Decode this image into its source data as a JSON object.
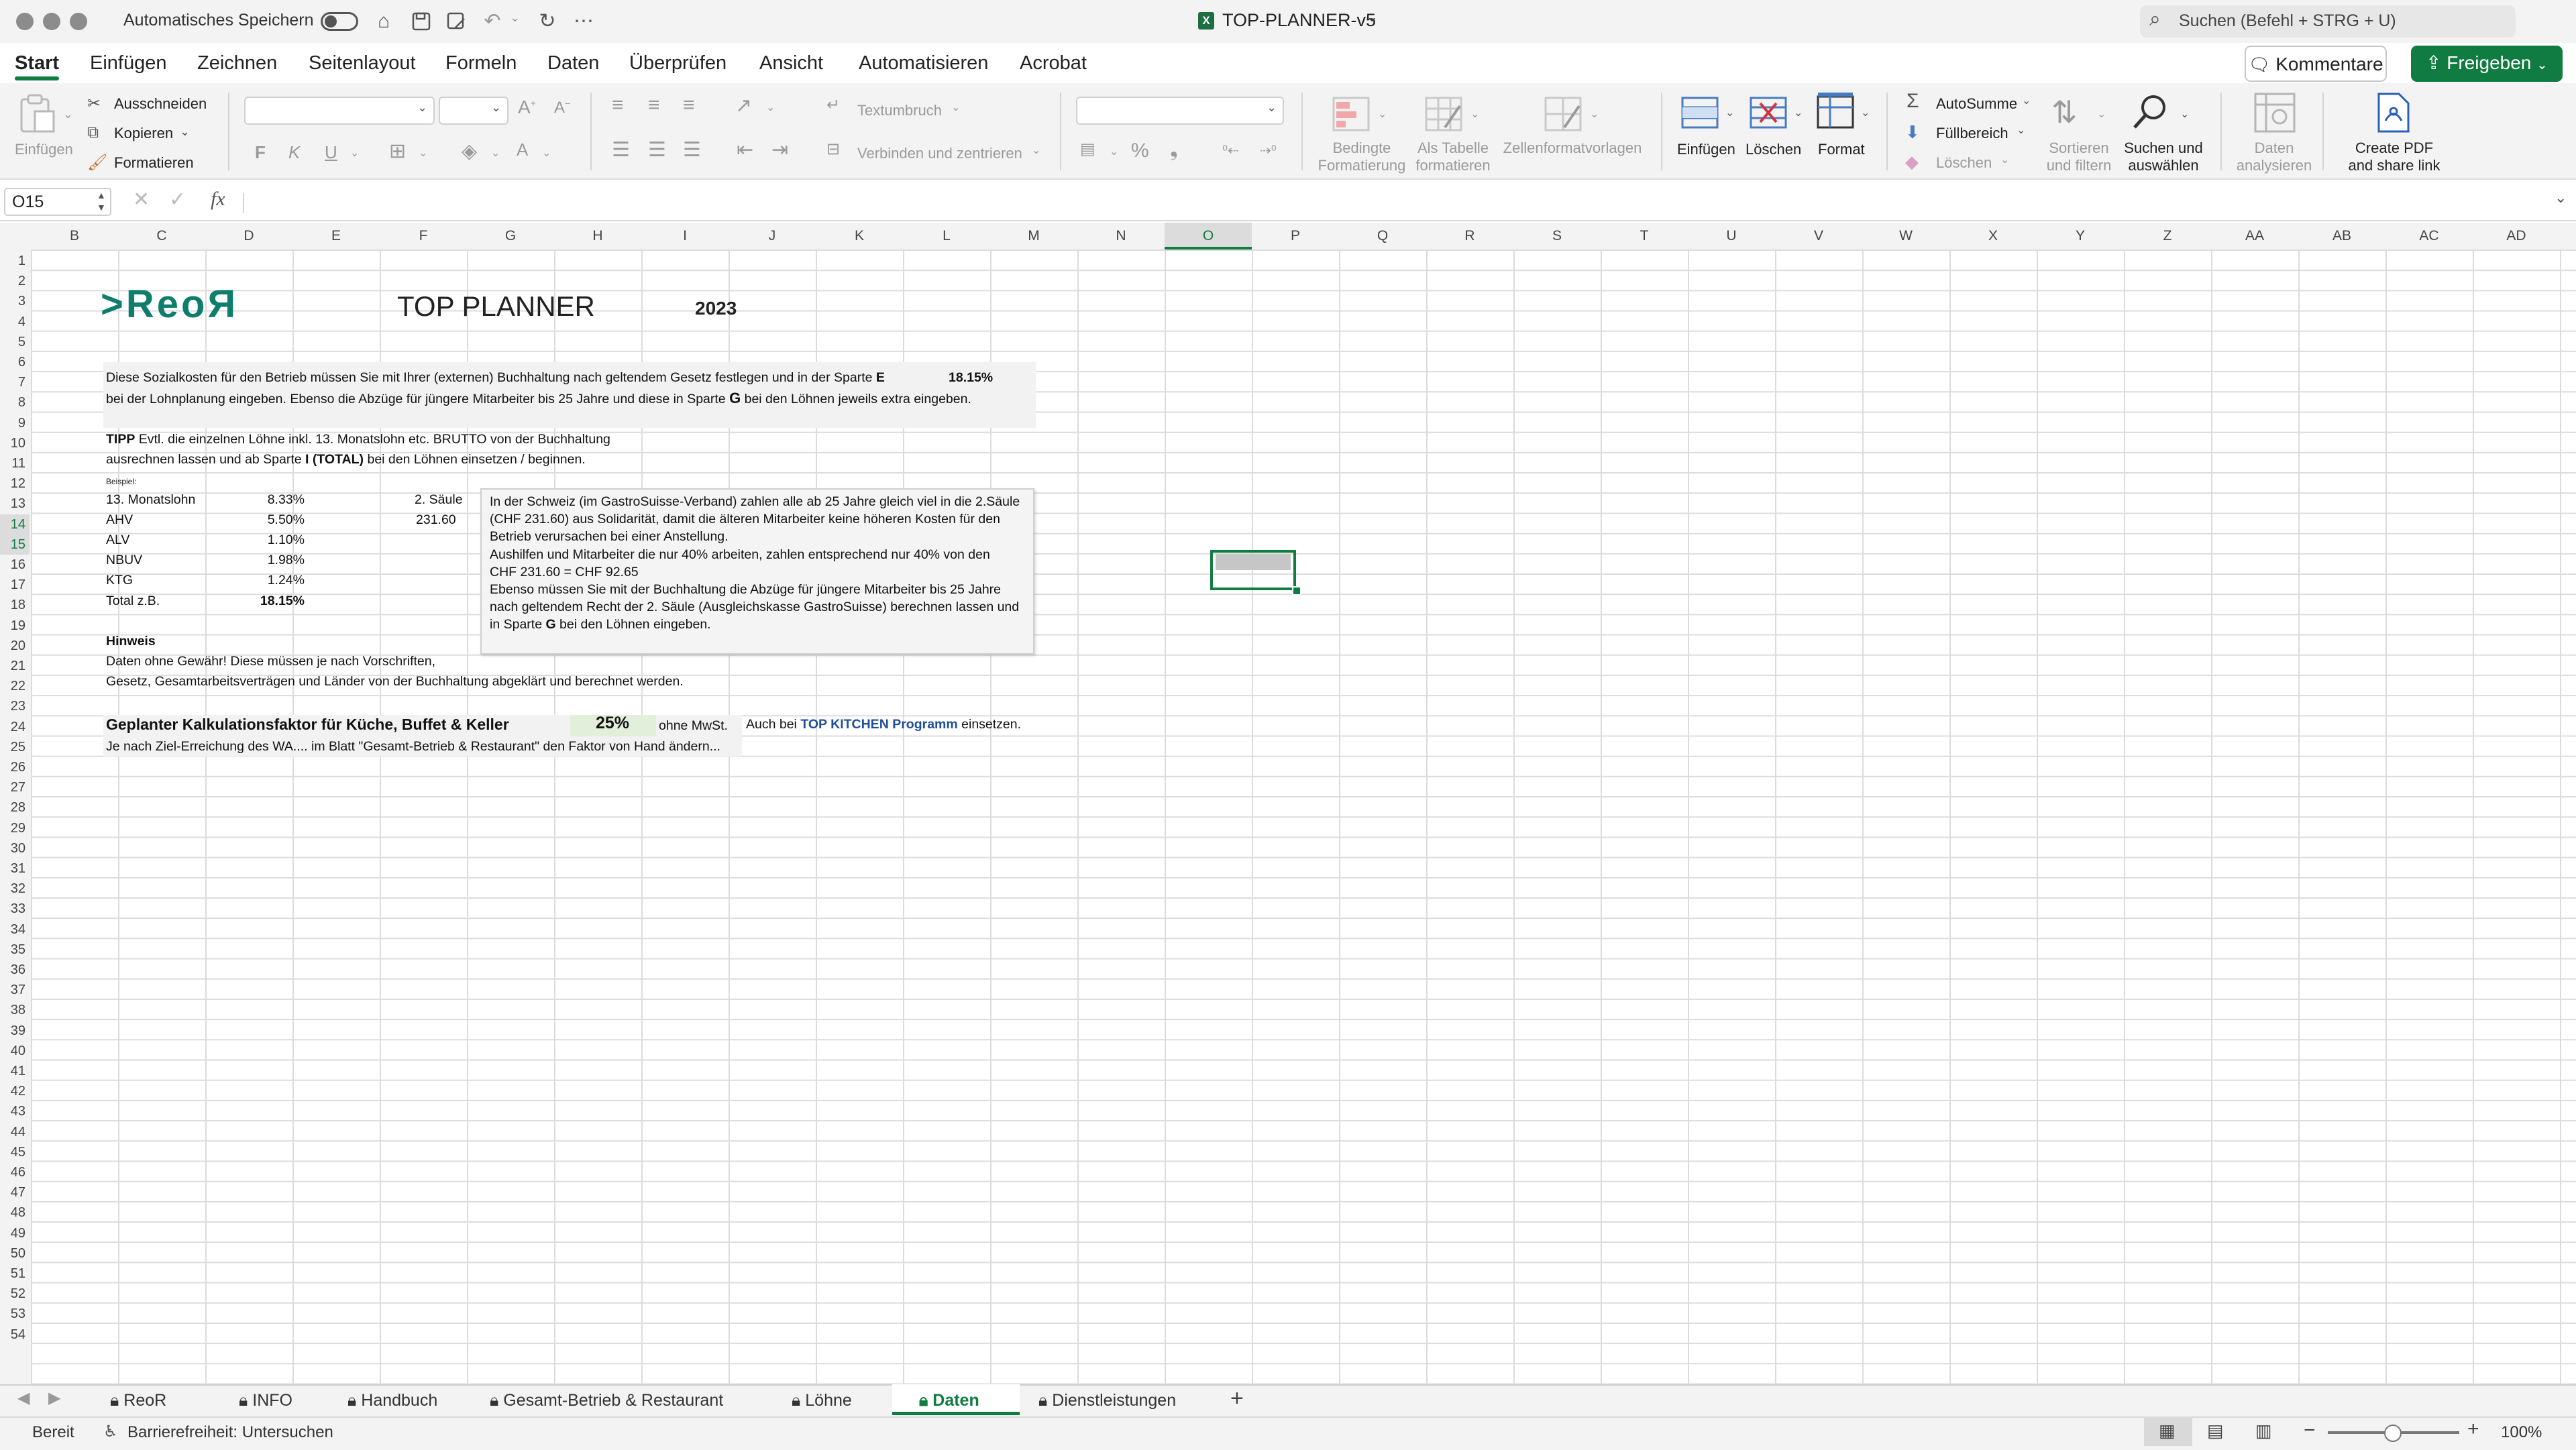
{
  "titlebar": {
    "autosave_label": "Automatisches Speichern",
    "doc_title": "TOP-PLANNER-v5",
    "search_placeholder": "Suchen (Befehl + STRG + U)"
  },
  "tabs": [
    "Start",
    "Einfügen",
    "Zeichnen",
    "Seitenlayout",
    "Formeln",
    "Daten",
    "Überprüfen",
    "Ansicht",
    "Automatisieren",
    "Acrobat"
  ],
  "actions": {
    "comment": "Kommentare",
    "share": "Freigeben"
  },
  "ribbon": {
    "paste": "Einfügen",
    "cut": "Ausschneiden",
    "copy": "Kopieren",
    "format_painter": "Formatieren",
    "bold": "F",
    "italic": "K",
    "underline": "U",
    "wrap": "Textumbruch",
    "merge": "Verbinden und zentrieren",
    "cond_format_1": "Bedingte",
    "cond_format_2": "Formatierung",
    "as_table_1": "Als Tabelle",
    "as_table_2": "formatieren",
    "cell_styles": "Zellenformatvorlagen",
    "insert": "Einfügen",
    "delete": "Löschen",
    "format": "Format",
    "autosum": "AutoSumme",
    "fill": "Füllbereich",
    "clear": "Löschen",
    "sort_1": "Sortieren",
    "sort_2": "und filtern",
    "find_1": "Suchen und",
    "find_2": "auswählen",
    "analyze_1": "Daten",
    "analyze_2": "analysieren",
    "pdf_1": "Create PDF",
    "pdf_2": "and share link"
  },
  "formula": {
    "name_box": "O15",
    "fx": "fx"
  },
  "columns": [
    "B",
    "C",
    "D",
    "E",
    "F",
    "G",
    "H",
    "I",
    "J",
    "K",
    "L",
    "M",
    "N",
    "O",
    "P",
    "Q",
    "R",
    "S",
    "T",
    "U",
    "V",
    "W",
    "X",
    "Y",
    "Z",
    "AA",
    "AB",
    "AC",
    "AD"
  ],
  "rows": [
    "1",
    "2",
    "3",
    "4",
    "5",
    "6",
    "7",
    "8",
    "9",
    "10",
    "11",
    "12",
    "13",
    "14",
    "15",
    "16",
    "17",
    "18",
    "19",
    "20",
    "21",
    "22",
    "23",
    "24",
    "25",
    "26",
    "27",
    "28",
    "29",
    "30",
    "31",
    "32",
    "33",
    "34",
    "35",
    "36",
    "37",
    "38",
    "39",
    "40",
    "41",
    "42",
    "43",
    "44",
    "45",
    "46",
    "47",
    "48",
    "49",
    "50",
    "51",
    "52",
    "53",
    "54"
  ],
  "sheet": {
    "logo": ">ReoЯ",
    "title": "TOP PLANNER",
    "year": "2023",
    "r5": "Diese Sozialkosten für den Betrieb müssen Sie mit Ihrer (externen) Buchhaltung nach geltendem Gesetz festlegen und in der Sparte ",
    "r5_bold": "E",
    "r5_pct": "18.15%",
    "r6_a": "bei der Lohnplanung eingeben. Ebenso die Abzüge für jüngere Mitarbeiter bis 25 Jahre und diese in Sparte ",
    "r6_bold": "G",
    "r6_b": " bei den Löhnen jeweils extra eingeben.",
    "r8_bold": "TIPP",
    "r8": " Evtl. die einzelnen Löhne inkl. 13. Monatslohn etc. BRUTTO von der Buchhaltung",
    "r9_a": "ausrechnen lassen und ab Sparte ",
    "r9_bold": "I  (TOTAL)",
    "r9_b": " bei den Löhnen einsetzen / beginnen.",
    "r10": "Beispiel:",
    "items": [
      {
        "label": "13. Monatslohn",
        "value": "8.33%"
      },
      {
        "label": "AHV",
        "value": "5.50%"
      },
      {
        "label": "ALV",
        "value": "1.10%"
      },
      {
        "label": "NBUV",
        "value": "1.98%"
      },
      {
        "label": "KTG",
        "value": "1.24%"
      },
      {
        "label": "Total z.B.",
        "value": "18.15%"
      }
    ],
    "saule_label": "2. Säule",
    "saule_value": "231.60",
    "note_lines": [
      "In der Schweiz (im GastroSuisse-Verband) zahlen alle ab 25 Jahre gleich viel in die 2.Säule",
      "(CHF 231.60)  aus Solidarität, damit die älteren Mitarbeiter keine höheren Kosten für den",
      "Betrieb verursachen bei einer Anstellung.",
      "Aushilfen und Mitarbeiter die nur 40%  arbeiten, zahlen entsprechend nur 40% von den",
      "CHF 231.60 = CHF 92.65",
      "Ebenso müssen Sie mit der Buchhaltung die Abzüge für jüngere Mitarbeiter bis 25 Jahre",
      "nach geltendem Recht der 2. Säule (Ausgleichskasse GastroSuisse) berechnen lassen und"
    ],
    "note_last_a": "in Sparte ",
    "note_last_bold": "G",
    "note_last_b": " bei den Löhnen eingeben.",
    "hint_title": "Hinweis",
    "hint_1": "Daten ohne Gewähr! Diese müssen je nach Vorschriften,",
    "hint_2": "Gesetz, Gesamtarbeitsverträgen und Länder von der Buchhaltung abgeklärt und berechnet werden.",
    "r22_label": "Geplanter Kalkulationsfaktor für Küche, Buffet & Keller",
    "r22_pct": "25%",
    "r22_vat": "ohne MwSt.",
    "r22_also_a": "Auch bei ",
    "r22_also_link": "TOP KITCHEN Programm",
    "r22_also_b": " einsetzen.",
    "r23": "Je nach Ziel-Erreichung des WA.... im Blatt \"Gesamt-Betrieb & Restaurant\" den Faktor von Hand ändern..."
  },
  "sheet_tabs": [
    "ReoR",
    "INFO",
    "Handbuch",
    "Gesamt-Betrieb & Restaurant",
    "Löhne",
    "Daten",
    "Dienstleistungen"
  ],
  "active_sheet": "Daten",
  "status": {
    "ready": "Bereit",
    "accessibility": "Barrierefreiheit: Untersuchen",
    "zoom": "100%"
  },
  "colors": {
    "accent": "#107c41",
    "link": "#1f4e9c",
    "logo": "#0d7d6c"
  }
}
